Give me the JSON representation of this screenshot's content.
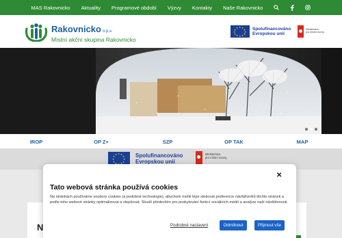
{
  "topnav": {
    "items": [
      "MAS Rakovnicko",
      "Aktuality",
      "Programové období",
      "Výzvy",
      "Kontakty",
      "Naše Rakovnicko"
    ],
    "icons": [
      "search-icon",
      "facebook-icon",
      "instagram-icon"
    ]
  },
  "header": {
    "org_name": "Rakovnicko",
    "org_suffix": "o.p.s.",
    "org_subtitle": "Místní akční skupina Rakovnicko",
    "eu_text_line1": "Spolufinancováno",
    "eu_text_line2": "Evropskou unií",
    "mmr_line1": "Ministerstvo",
    "mmr_line2": "pro místní rozvoj"
  },
  "programs": [
    "IROP",
    "OP Z+",
    "SZP",
    "OP TAK",
    "MAP"
  ],
  "eu_band": {
    "eu_text_line1": "Spolufinancováno",
    "eu_text_line2": "Evropskou unií",
    "mmr_line1": "Ministerstvo",
    "mmr_line2": "pro místní rozvoj"
  },
  "slider": {
    "slide_count": 3,
    "active_index": 1
  },
  "section": {
    "heading_initial": "N"
  },
  "cookie": {
    "title": "Tato webová stránka používá cookies",
    "text": "Na stránkách používáme soubory cookies (a podobné technologie), abychom mohli lépe sledovat preference návštěvníků těchto stránek a podle toho webové stránky optimalizovat a zlepšovat. Slouží především pro poskytování funkcí sociálních médií a analýze naší návštěvnosti.",
    "prefs_link": "Podrobné nastavení",
    "reject_label": "Odmítnout",
    "accept_label": "Přijmout vše"
  },
  "colors": {
    "brand_green": "#2e8a34",
    "brand_blue": "#1d5fa3",
    "eu_blue": "#1a3f9a",
    "button_blue": "#1a63c8"
  }
}
